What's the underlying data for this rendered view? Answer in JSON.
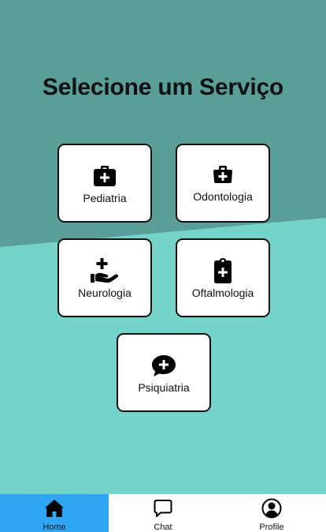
{
  "title": "Selecione um Serviço",
  "services": [
    {
      "label": "Pediatria",
      "icon": "medical-kit-icon"
    },
    {
      "label": "Odontologia",
      "icon": "medical-bag-icon"
    },
    {
      "label": "Neurologia",
      "icon": "hand-holding-medical-icon"
    },
    {
      "label": "Oftalmologia",
      "icon": "clipboard-medical-icon"
    },
    {
      "label": "Psiquiatria",
      "icon": "speech-bubble-plus-icon"
    }
  ],
  "tabs": [
    {
      "label": "Home",
      "icon": "home-icon",
      "active": true
    },
    {
      "label": "Chat",
      "icon": "chat-bubble-icon",
      "active": false
    },
    {
      "label": "Profile",
      "icon": "user-circle-icon",
      "active": false
    }
  ],
  "colors": {
    "background_top": "#5a9e98",
    "background_bottom": "#74d4ca",
    "active_tab": "#2fa6f4"
  }
}
